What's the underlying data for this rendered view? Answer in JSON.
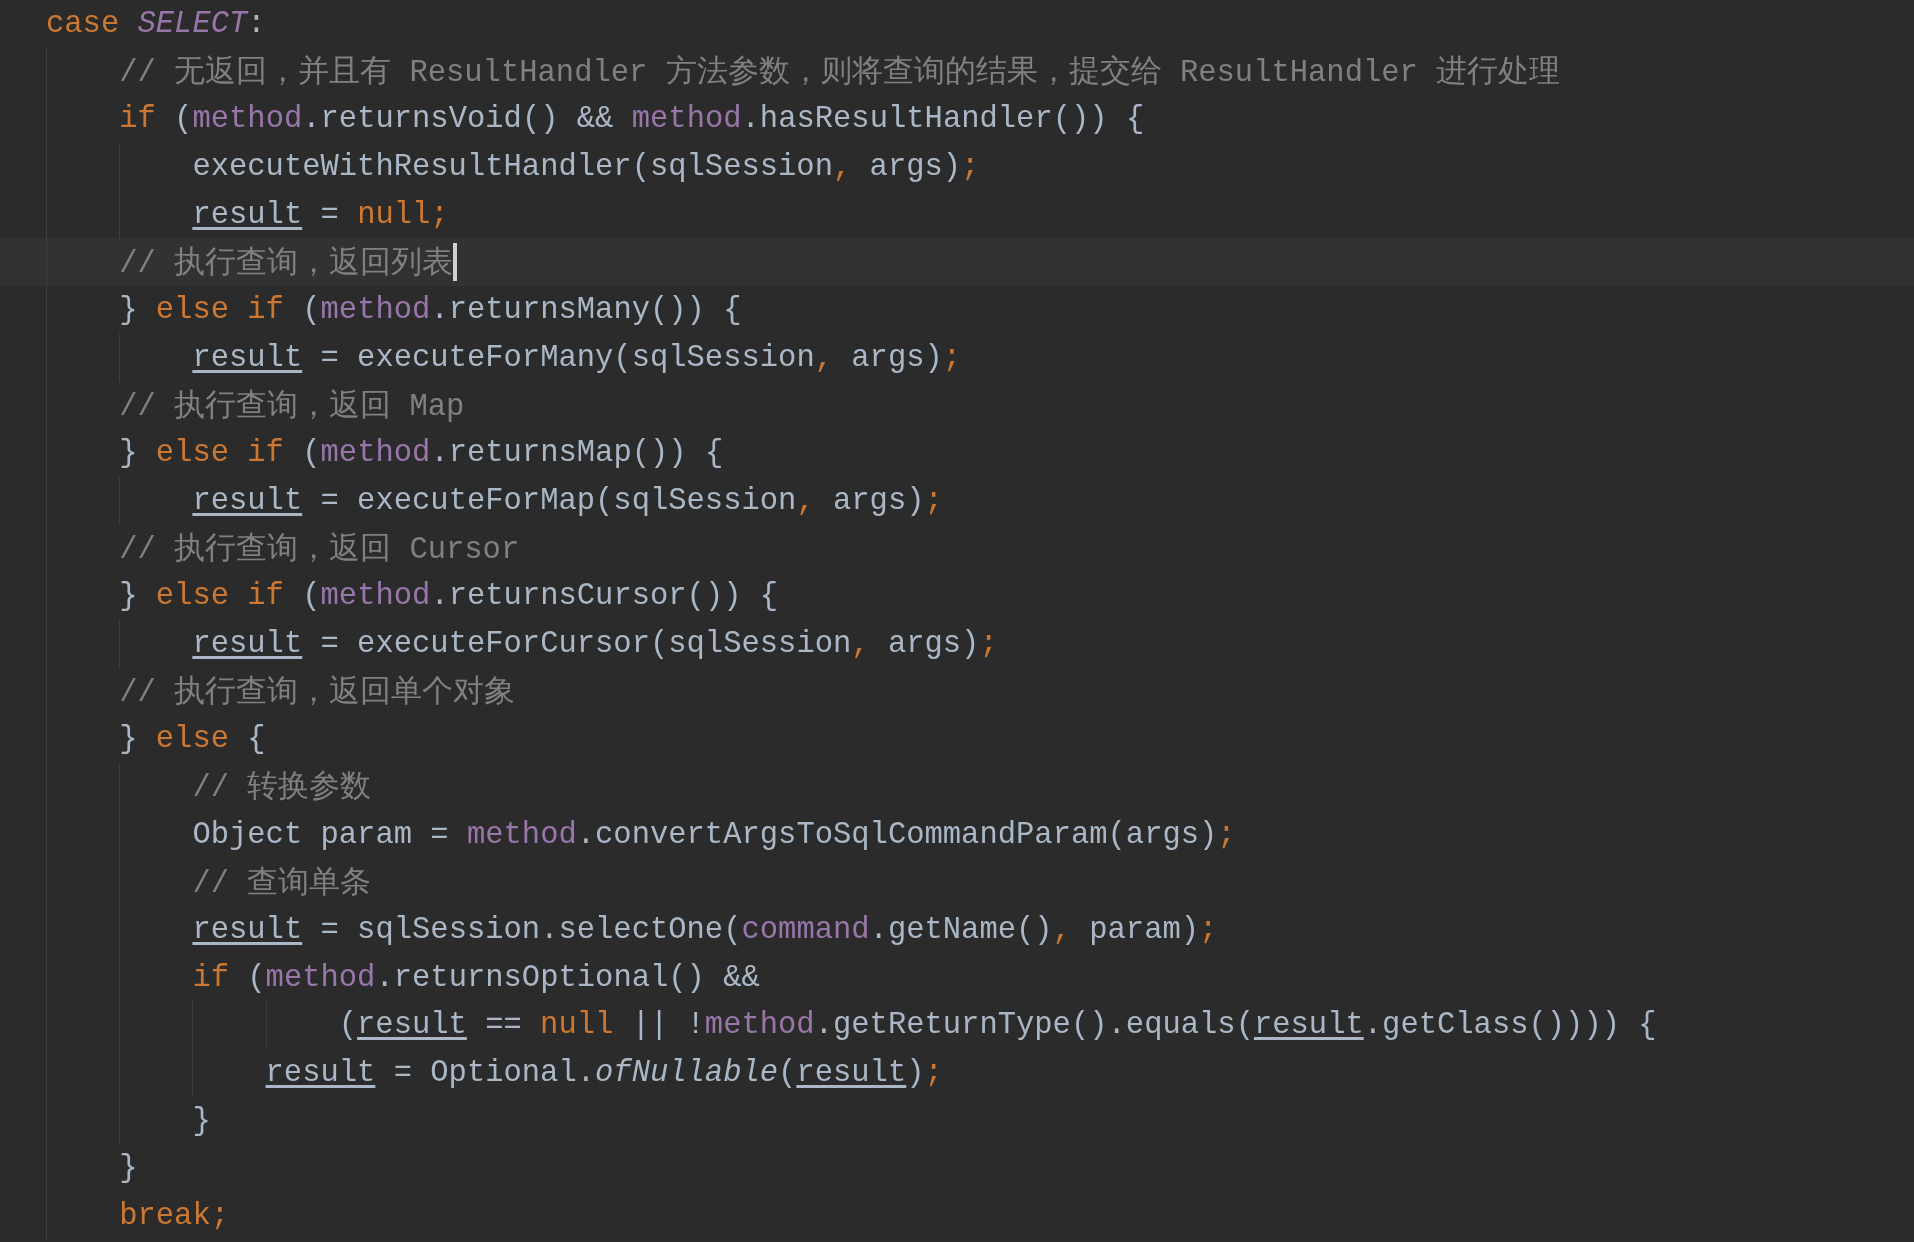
{
  "editor": {
    "lines": [
      {
        "current": false,
        "tokens": [
          {
            "kind": "keyword",
            "text": "case "
          },
          {
            "kind": "constant",
            "text": "SELECT"
          },
          {
            "kind": "plain",
            "text": ":"
          }
        ],
        "children": [
          {
            "current": false,
            "tokens": [
              {
                "kind": "comment",
                "text": "// 无返回，并且有 ResultHandler 方法参数，则将查询的结果，提交给 ResultHandler 进行处理"
              }
            ]
          },
          {
            "current": false,
            "tokens": [
              {
                "kind": "keyword",
                "text": "if "
              },
              {
                "kind": "plain",
                "text": "("
              },
              {
                "kind": "field",
                "text": "method"
              },
              {
                "kind": "plain",
                "text": ".returnsVoid() && "
              },
              {
                "kind": "field",
                "text": "method"
              },
              {
                "kind": "plain",
                "text": ".hasResultHandler()) {"
              }
            ],
            "children": [
              {
                "current": false,
                "tokens": [
                  {
                    "kind": "plain",
                    "text": "executeWithResultHandler(sqlSession"
                  },
                  {
                    "kind": "punct",
                    "text": ", "
                  },
                  {
                    "kind": "plain",
                    "text": "args)"
                  },
                  {
                    "kind": "punct",
                    "text": ";"
                  }
                ]
              },
              {
                "current": false,
                "tokens": [
                  {
                    "kind": "variable",
                    "text": "result"
                  },
                  {
                    "kind": "plain",
                    "text": " = "
                  },
                  {
                    "kind": "keyword",
                    "text": "null;"
                  }
                ]
              }
            ]
          },
          {
            "current": true,
            "tokens": [
              {
                "kind": "comment",
                "text": "// 执行查询，返回列表"
              }
            ]
          },
          {
            "current": false,
            "tokens": [
              {
                "kind": "plain",
                "text": "} "
              },
              {
                "kind": "keyword",
                "text": "else if "
              },
              {
                "kind": "plain",
                "text": "("
              },
              {
                "kind": "field",
                "text": "method"
              },
              {
                "kind": "plain",
                "text": ".returnsMany()) {"
              }
            ],
            "children": [
              {
                "current": false,
                "tokens": [
                  {
                    "kind": "variable",
                    "text": "result"
                  },
                  {
                    "kind": "plain",
                    "text": " = executeForMany(sqlSession"
                  },
                  {
                    "kind": "punct",
                    "text": ", "
                  },
                  {
                    "kind": "plain",
                    "text": "args)"
                  },
                  {
                    "kind": "punct",
                    "text": ";"
                  }
                ]
              }
            ]
          },
          {
            "current": false,
            "tokens": [
              {
                "kind": "comment",
                "text": "// 执行查询，返回 Map"
              }
            ]
          },
          {
            "current": false,
            "tokens": [
              {
                "kind": "plain",
                "text": "} "
              },
              {
                "kind": "keyword",
                "text": "else if "
              },
              {
                "kind": "plain",
                "text": "("
              },
              {
                "kind": "field",
                "text": "method"
              },
              {
                "kind": "plain",
                "text": ".returnsMap()) {"
              }
            ],
            "children": [
              {
                "current": false,
                "tokens": [
                  {
                    "kind": "variable",
                    "text": "result"
                  },
                  {
                    "kind": "plain",
                    "text": " = executeForMap(sqlSession"
                  },
                  {
                    "kind": "punct",
                    "text": ", "
                  },
                  {
                    "kind": "plain",
                    "text": "args)"
                  },
                  {
                    "kind": "punct",
                    "text": ";"
                  }
                ]
              }
            ]
          },
          {
            "current": false,
            "tokens": [
              {
                "kind": "comment",
                "text": "// 执行查询，返回 Cursor"
              }
            ]
          },
          {
            "current": false,
            "tokens": [
              {
                "kind": "plain",
                "text": "} "
              },
              {
                "kind": "keyword",
                "text": "else if "
              },
              {
                "kind": "plain",
                "text": "("
              },
              {
                "kind": "field",
                "text": "method"
              },
              {
                "kind": "plain",
                "text": ".returnsCursor()) {"
              }
            ],
            "children": [
              {
                "current": false,
                "tokens": [
                  {
                    "kind": "variable",
                    "text": "result"
                  },
                  {
                    "kind": "plain",
                    "text": " = executeForCursor(sqlSession"
                  },
                  {
                    "kind": "punct",
                    "text": ", "
                  },
                  {
                    "kind": "plain",
                    "text": "args)"
                  },
                  {
                    "kind": "punct",
                    "text": ";"
                  }
                ]
              }
            ]
          },
          {
            "current": false,
            "tokens": [
              {
                "kind": "comment",
                "text": "// 执行查询，返回单个对象"
              }
            ]
          },
          {
            "current": false,
            "tokens": [
              {
                "kind": "plain",
                "text": "} "
              },
              {
                "kind": "keyword",
                "text": "else "
              },
              {
                "kind": "plain",
                "text": "{"
              }
            ],
            "children": [
              {
                "current": false,
                "tokens": [
                  {
                    "kind": "comment",
                    "text": "// 转换参数"
                  }
                ]
              },
              {
                "current": false,
                "tokens": [
                  {
                    "kind": "plain",
                    "text": "Object param = "
                  },
                  {
                    "kind": "field",
                    "text": "method"
                  },
                  {
                    "kind": "plain",
                    "text": ".convertArgsToSqlCommandParam(args)"
                  },
                  {
                    "kind": "punct",
                    "text": ";"
                  }
                ]
              },
              {
                "current": false,
                "tokens": [
                  {
                    "kind": "comment",
                    "text": "// 查询单条"
                  }
                ]
              },
              {
                "current": false,
                "tokens": [
                  {
                    "kind": "variable",
                    "text": "result"
                  },
                  {
                    "kind": "plain",
                    "text": " = sqlSession.selectOne("
                  },
                  {
                    "kind": "field",
                    "text": "command"
                  },
                  {
                    "kind": "plain",
                    "text": ".getName()"
                  },
                  {
                    "kind": "punct",
                    "text": ", "
                  },
                  {
                    "kind": "plain",
                    "text": "param)"
                  },
                  {
                    "kind": "punct",
                    "text": ";"
                  }
                ]
              },
              {
                "current": false,
                "tokens": [
                  {
                    "kind": "keyword",
                    "text": "if "
                  },
                  {
                    "kind": "plain",
                    "text": "("
                  },
                  {
                    "kind": "field",
                    "text": "method"
                  },
                  {
                    "kind": "plain",
                    "text": ".returnsOptional() &&"
                  }
                ],
                "children": [
                  {
                    "kind": "continuation",
                    "current": false,
                    "tokens": [
                      {
                        "kind": "plain",
                        "text": "("
                      },
                      {
                        "kind": "variable",
                        "text": "result"
                      },
                      {
                        "kind": "plain",
                        "text": " == "
                      },
                      {
                        "kind": "keyword",
                        "text": "null "
                      },
                      {
                        "kind": "plain",
                        "text": "|| !"
                      },
                      {
                        "kind": "field",
                        "text": "method"
                      },
                      {
                        "kind": "plain",
                        "text": ".getReturnType().equals("
                      },
                      {
                        "kind": "variable",
                        "text": "result"
                      },
                      {
                        "kind": "plain",
                        "text": ".getClass()))) {"
                      }
                    ]
                  },
                  {
                    "current": false,
                    "tokens": [
                      {
                        "kind": "variable",
                        "text": "result"
                      },
                      {
                        "kind": "plain",
                        "text": " = Optional."
                      },
                      {
                        "kind": "static-call",
                        "text": "ofNullable"
                      },
                      {
                        "kind": "plain",
                        "text": "("
                      },
                      {
                        "kind": "variable",
                        "text": "result"
                      },
                      {
                        "kind": "plain",
                        "text": ")"
                      },
                      {
                        "kind": "punct",
                        "text": ";"
                      }
                    ]
                  }
                ]
              },
              {
                "current": false,
                "tokens": [
                  {
                    "kind": "plain",
                    "text": "}"
                  }
                ]
              }
            ]
          },
          {
            "current": false,
            "tokens": [
              {
                "kind": "plain",
                "text": "}"
              }
            ]
          },
          {
            "current": false,
            "tokens": [
              {
                "kind": "keyword",
                "text": "break;"
              }
            ]
          }
        ]
      }
    ]
  }
}
